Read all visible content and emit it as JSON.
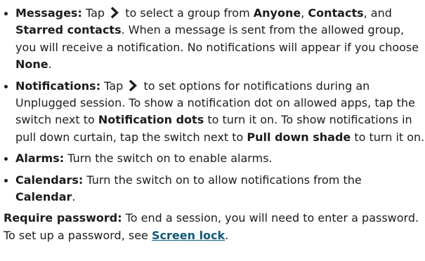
{
  "items": [
    {
      "label": "Messages:",
      "p1": "Tap",
      "p2": "to select a group from",
      "opt1": "Anyone",
      "sep1": ",",
      "opt2": "Contacts",
      "sep2": ", and",
      "opt3": "Starred contacts",
      "p3": ". When a message is sent from the allowed group, you will receive a notification. No notifications will appear if you choose",
      "opt4": "None",
      "end": "."
    },
    {
      "label": "Notifications:",
      "p1": "Tap",
      "p2": "to set options for notifications during an Unplugged session. To show a notification dot on allowed apps, tap the switch next to",
      "opt1": "Notification dots",
      "p3": "to turn it on. To show notifications in pull down curtain, tap the switch next to",
      "opt2": "Pull down shade",
      "p4": "to turn it on."
    },
    {
      "label": "Alarms:",
      "text": "Turn the switch on to enable alarms."
    },
    {
      "label": "Calendars:",
      "text": "Turn the switch on to allow notifications from the",
      "opt1": "Calendar",
      "end": "."
    }
  ],
  "require": {
    "label": "Require password:",
    "text": "To end a session, you will need to enter a password. To set up a password, see",
    "link": "Screen lock",
    "end": "."
  },
  "icons": {
    "chevron": "chevron-right-icon"
  },
  "colors": {
    "text": "#1c1c1c",
    "link": "#0d5a78"
  }
}
